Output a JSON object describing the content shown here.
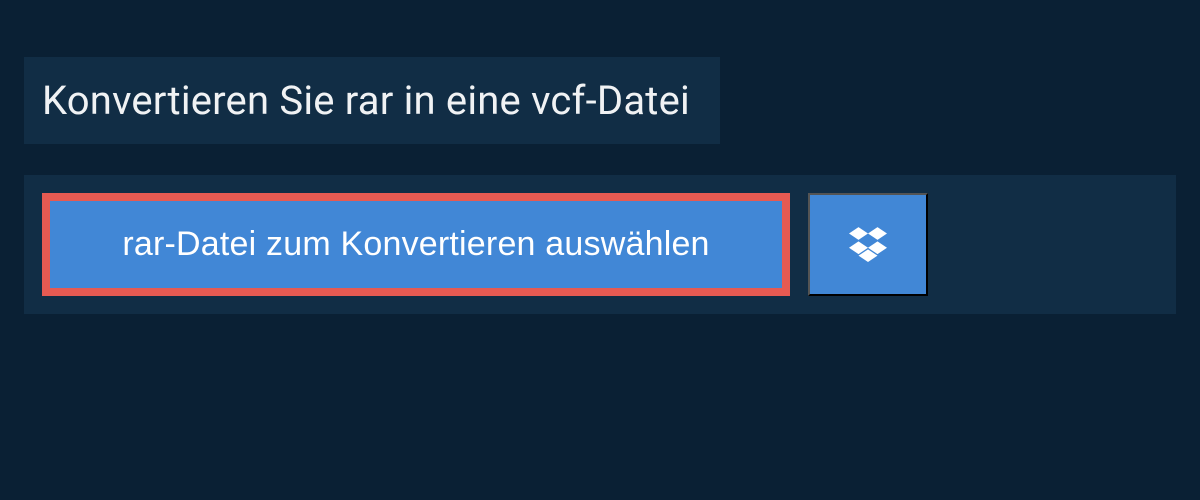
{
  "heading": {
    "title": "Konvertieren Sie rar in eine vcf-Datei"
  },
  "actions": {
    "select_file_label": "rar-Datei zum Konvertieren auswählen",
    "dropbox_icon_name": "dropbox-icon"
  },
  "colors": {
    "background": "#0a2034",
    "panel": "#112d45",
    "button": "#4187d6",
    "highlight_border": "#e65a52",
    "text": "#ffffff"
  }
}
